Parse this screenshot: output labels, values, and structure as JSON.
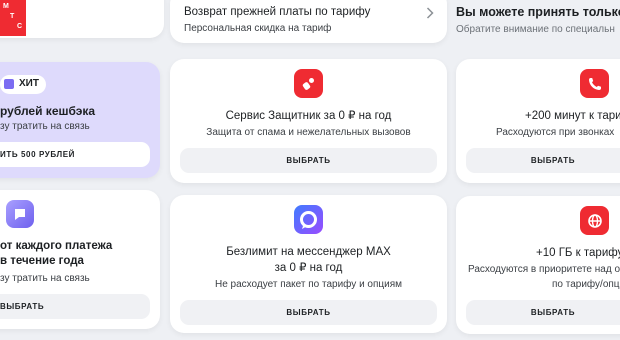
{
  "logo": {
    "letters": [
      "М",
      "Т",
      "С"
    ]
  },
  "top_middle": {
    "title": "Возврат прежней платы по тарифу",
    "subtitle": "Персональная скидка на тариф"
  },
  "top_right": {
    "title": "Вы можете принять только о",
    "subtitle": "Обратите внимание по специальн"
  },
  "promo_hit": {
    "badge": "ХИТ",
    "title": "рублей кешбэка",
    "subtitle": "зу тратить на связь",
    "button": "ИТЬ 500 РУБЛЕЙ"
  },
  "card_protector": {
    "title": "Сервис Защитник за 0 ₽ на год",
    "subtitle": "Защита от спама и нежелательных вызовов",
    "button": "ВЫБРАТЬ"
  },
  "card_minutes": {
    "title": "+200 минут к тари",
    "subtitle": "Расходуются при звонках",
    "button": "ВЫБРАТЬ"
  },
  "card_cashback": {
    "line1": "от каждого платежа",
    "line2": "в течение года",
    "subtitle": "зу тратить на связь",
    "button": "ВЫБРАТЬ"
  },
  "card_max": {
    "line1": "Безлимит на мессенджер MAX",
    "line2": "за 0 ₽ на год",
    "subtitle": "Не расходует пакет по тарифу и опциям",
    "button": "ВЫБРАТЬ"
  },
  "card_gb": {
    "title": "+10 ГБ к тарифу",
    "line1": "Расходуются в приоритете над о",
    "line2": "по тарифу/опц",
    "button": "ВЫБРАТЬ"
  },
  "colors": {
    "brand_red": "#ef2b32",
    "promo_bg": "#ddd9fb",
    "accent_purple": "#7b6cf2"
  }
}
